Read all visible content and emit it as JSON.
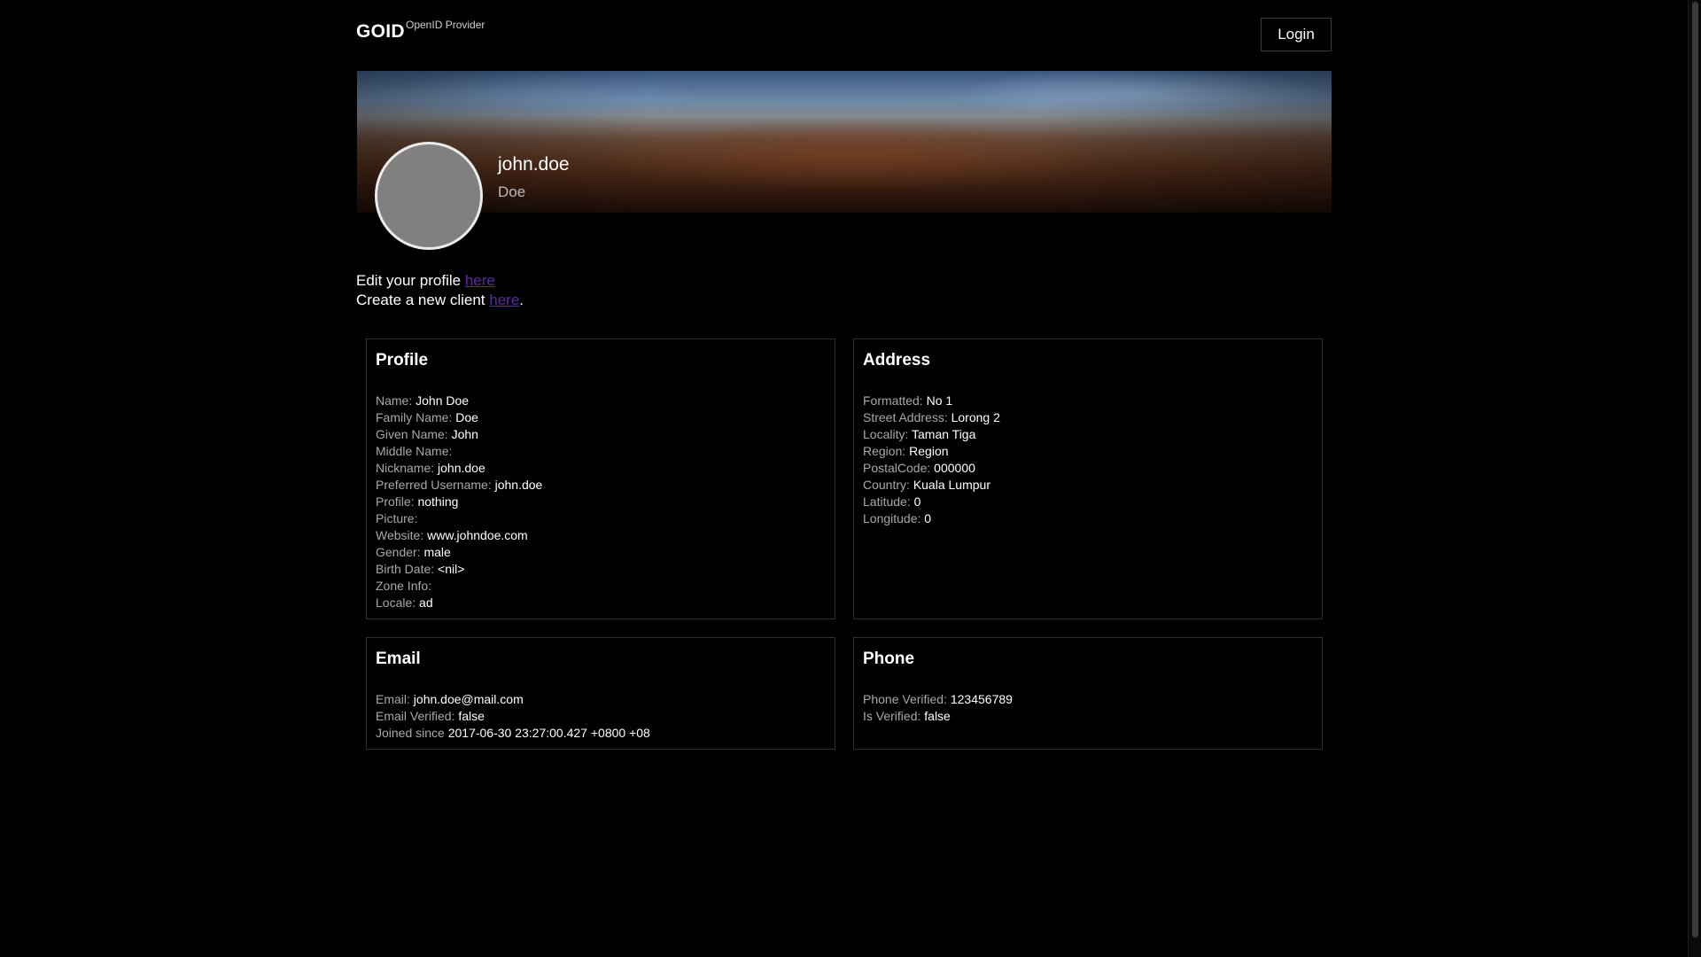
{
  "header": {
    "brand": "GOID",
    "brand_sub": "OpenID Provider",
    "login_label": "Login"
  },
  "banner": {
    "username": "john.doe",
    "family_name": "Doe"
  },
  "links": {
    "edit_prefix": "Edit your profile ",
    "edit_link": "here",
    "create_prefix": "Create a new client ",
    "create_link": "here",
    "create_suffix": "."
  },
  "profile": {
    "title": "Profile",
    "fields": [
      {
        "label": "Name:",
        "value": "John Doe"
      },
      {
        "label": "Family Name:",
        "value": "Doe"
      },
      {
        "label": "Given Name:",
        "value": "John"
      },
      {
        "label": "Middle Name:",
        "value": ""
      },
      {
        "label": "Nickname:",
        "value": "john.doe"
      },
      {
        "label": "Preferred Username:",
        "value": "john.doe"
      },
      {
        "label": "Profile:",
        "value": "nothing"
      },
      {
        "label": "Picture:",
        "value": ""
      },
      {
        "label": "Website:",
        "value": "www.johndoe.com"
      },
      {
        "label": "Gender:",
        "value": "male"
      },
      {
        "label": "Birth Date:",
        "value": "<nil>"
      },
      {
        "label": "Zone Info:",
        "value": ""
      },
      {
        "label": "Locale:",
        "value": "ad"
      }
    ]
  },
  "address": {
    "title": "Address",
    "fields": [
      {
        "label": "Formatted:",
        "value": "No 1"
      },
      {
        "label": "Street Address:",
        "value": "Lorong 2"
      },
      {
        "label": "Locality:",
        "value": "Taman Tiga"
      },
      {
        "label": "Region:",
        "value": "Region"
      },
      {
        "label": "PostalCode:",
        "value": "000000"
      },
      {
        "label": "Country:",
        "value": "Kuala Lumpur"
      },
      {
        "label": "Latitude:",
        "value": "0"
      },
      {
        "label": "Longitude:",
        "value": "0"
      }
    ]
  },
  "email": {
    "title": "Email",
    "fields": [
      {
        "label": "Email:",
        "value": "john.doe@mail.com"
      },
      {
        "label": "Email Verified:",
        "value": "false"
      },
      {
        "label": "Joined since",
        "value": "2017-06-30 23:27:00.427 +0800 +08"
      }
    ]
  },
  "phone": {
    "title": "Phone",
    "fields": [
      {
        "label": "Phone Verified:",
        "value": "123456789"
      },
      {
        "label": "Is Verified:",
        "value": "false"
      }
    ]
  }
}
